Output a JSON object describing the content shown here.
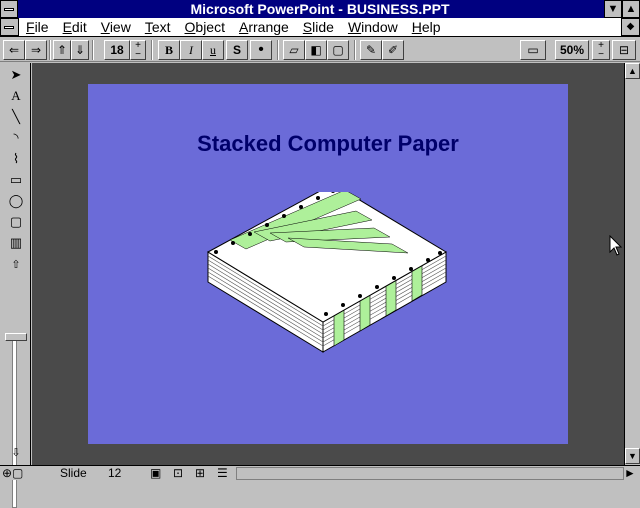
{
  "window": {
    "title": "Microsoft PowerPoint - BUSINESS.PPT"
  },
  "menu": {
    "items": [
      {
        "label": "File",
        "accel": "F",
        "rest": "ile"
      },
      {
        "label": "Edit",
        "accel": "E",
        "rest": "dit"
      },
      {
        "label": "View",
        "accel": "V",
        "rest": "iew"
      },
      {
        "label": "Text",
        "accel": "T",
        "rest": "ext"
      },
      {
        "label": "Object",
        "accel": "O",
        "rest": "bject"
      },
      {
        "label": "Arrange",
        "accel": "A",
        "rest": "rrange"
      },
      {
        "label": "Slide",
        "accel": "S",
        "rest": "lide"
      },
      {
        "label": "Window",
        "accel": "W",
        "rest": "indow"
      },
      {
        "label": "Help",
        "accel": "H",
        "rest": "elp"
      }
    ]
  },
  "toolbar": {
    "font_size": "18",
    "bold": "B",
    "italic": "I",
    "underline": "u",
    "shadow": "S",
    "bullet": "•",
    "zoom": "50%"
  },
  "slide": {
    "title": "Stacked Computer Paper"
  },
  "status": {
    "label": "Slide",
    "number": "12"
  },
  "colors": {
    "titlebar": "#000080",
    "slide_bg": "#6b6bd8",
    "workspace": "#4a4a4a",
    "paper_stripe": "#aef09a"
  }
}
